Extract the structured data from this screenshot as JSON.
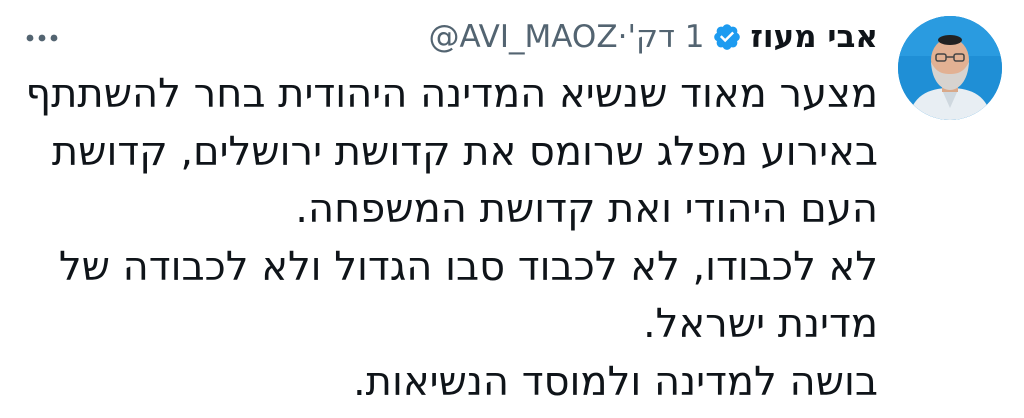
{
  "tweet": {
    "author": {
      "display_name": "אבי מעוז",
      "handle": "@AVI_MAOZ",
      "verified": true,
      "avatar_icon": "profile-photo"
    },
    "meta": {
      "separator": "·",
      "time": "1 דק'"
    },
    "more_icon": "ellipsis-icon",
    "lines": [
      "מצער מאוד שנשיא המדינה היהודית בחר להשתתף",
      "באירוע מפלג שרומס את קדושת ירושלים, קדושת",
      "העם היהודי ואת קדושת המשפחה.",
      "לא לכבודו, לא לכבוד סבו הגדול ולא לכבודה של",
      "מדינת ישראל.",
      "בושה למדינה ולמוסד הנשיאות."
    ]
  },
  "colors": {
    "text": "#0f1419",
    "secondary": "#536471",
    "verified": "#1d9bf0",
    "avatar_bg": "#1d8fd8"
  }
}
